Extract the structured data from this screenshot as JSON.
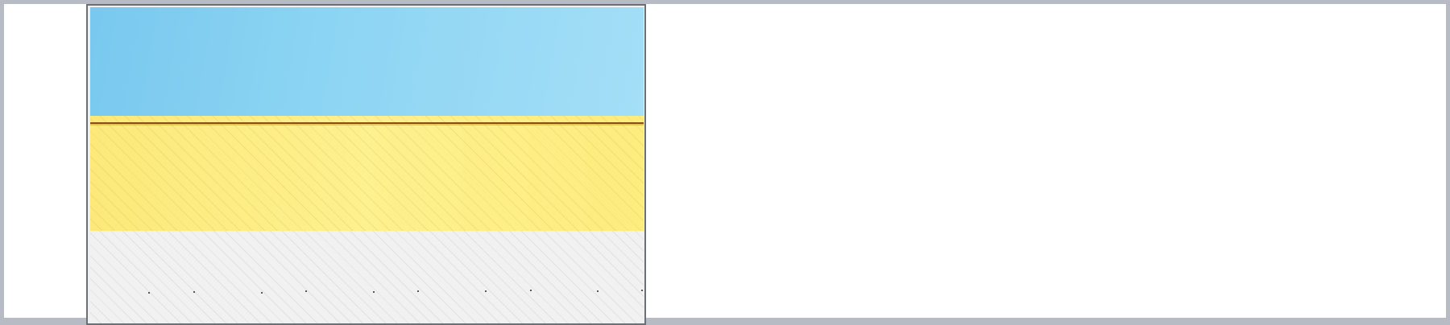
{
  "image": {
    "subject": "photo",
    "colors": {
      "sky": "#8dd5f3",
      "wall": "#fdf08e",
      "trim": "#8a4d12",
      "ground": "#f1f1f1",
      "frame_border": "#6b6f76",
      "background": "#b6bbc4"
    }
  }
}
